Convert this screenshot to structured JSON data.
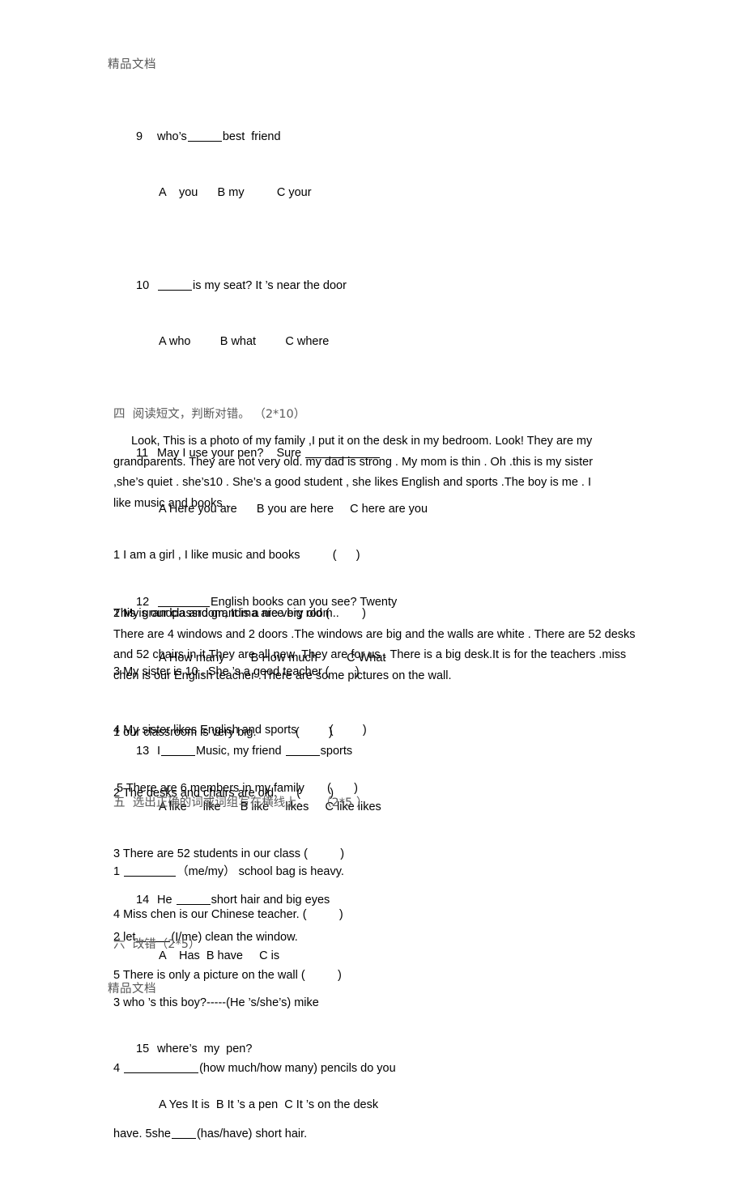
{
  "document": {
    "watermark_top": "精品文档",
    "watermark_bottom": "精品文档"
  },
  "multiple_choice": {
    "items": [
      {
        "number": "9",
        "stem_before": "who’s",
        "stem_after": "best  friend",
        "options": "A    you      B my          C your"
      },
      {
        "number": "10",
        "stem_before": "",
        "stem_after": "is my seat? It ’s near the door",
        "options": "A who         B what         C where"
      },
      {
        "number": "11",
        "stem_before": "May I use your pen?    Sure ",
        "stem_after": "",
        "options": "A Here you are      B you are here     C here are you"
      },
      {
        "number": "12",
        "stem_before": "",
        "stem_after": "English books can you see? Twenty",
        "options": "A How many        B How much         C What"
      },
      {
        "number": "13",
        "stem_before": "I",
        "stem_mid": "Music, my friend ",
        "stem_after": "sports",
        "options": "A like     like      B like     likes     C like likes"
      },
      {
        "number": "14",
        "stem_before": "He ",
        "stem_after": "short hair and big eyes",
        "options": "A    Has  B have     C is"
      },
      {
        "number": "15",
        "stem_before": "where’s  my  pen?",
        "stem_after": "",
        "options": "A Yes It is  B It ’s a pen  C It ’s on the desk"
      }
    ]
  },
  "section_four": {
    "heading": "四  阅读短文，判断对错。 （2*10）",
    "passage_one": {
      "line1": "Look, This is a photo of my family ,I put it on the desk in my bedroom. Look! They are my",
      "line2": "grandparents. They are not very old. my dad is strong . My mom is thin . Oh .this is my sister",
      "line3": ",she’s quiet . she’s10 . She’s a good student , she likes English and sports .The boy is me . I",
      "line4": "like music and books ."
    },
    "questions_one": [
      "1 I am a girl , I like music and books          (      )",
      "2 My grandpa and grandma are very old (          )",
      "3 My sister is 10 . She ’s a good teacher (        )",
      "4 My sister likes English and sports          (         )",
      " 5 There are 6 members in my family       (       )"
    ],
    "passage_two": {
      "line1": "This is our classroom, It is a nice big room..",
      "line2": "There are 4 windows and 2 doors .The windows are big and the walls are white . There are 52 desks",
      "line3": "and 52 chairs in it.They are all new .They are for us . There is a big desk.It is for the teachers .miss",
      "line4": "chen is our English teacher .There are some pictures on the wall."
    },
    "questions_two": [
      "1 our classroom is very big.            (         )",
      "2 The desks and chairs are old.      (         )",
      "3 There are 52 students in our class (          )",
      "4 Miss chen is our Chinese teacher. (          )",
      "5 There is only a picture on the wall (          )"
    ]
  },
  "section_five": {
    "heading": "五  选出正确的词或词组写在横线上。   （2*5 ）",
    "items": [
      {
        "prefix": "1 ",
        "suffix": "（me/my） school bag is heavy.",
        "gap": "medium"
      },
      {
        "prefix": "2 let",
        "suffix": "(I/me) clean the window.",
        "gap": "small"
      },
      {
        "prefix": "3 who ’s this boy?-----(He ’s/she’s) mike",
        "suffix": "",
        "gap": "none"
      },
      {
        "prefix": "4 ",
        "suffix": "(how much/how many) pencils do you",
        "gap": "large"
      },
      {
        "prefix": "have. 5she",
        "suffix": "(has/have) short hair.",
        "gap": "tiny"
      }
    ]
  },
  "section_six": {
    "heading": "六  改错（2*5）"
  }
}
